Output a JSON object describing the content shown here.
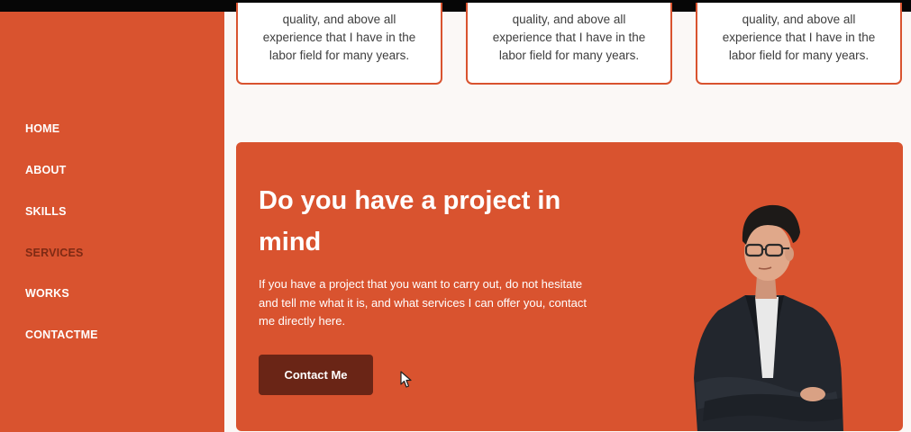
{
  "nav": {
    "items": [
      {
        "label": "HOME",
        "active": false
      },
      {
        "label": "ABOUT",
        "active": false
      },
      {
        "label": "SKILLS",
        "active": false
      },
      {
        "label": "SERVICES",
        "active": true
      },
      {
        "label": "WORKS",
        "active": false
      },
      {
        "label": "CONTACTME",
        "active": false
      }
    ]
  },
  "service_cards": [
    {
      "lines": [
        "quality, and above all",
        "experience that I have in the",
        "labor field for many years."
      ]
    },
    {
      "lines": [
        "quality, and above all",
        "experience that I have in the",
        "labor field for many years."
      ]
    },
    {
      "lines": [
        "quality, and above all",
        "experience that I have in the",
        "labor field for many years."
      ]
    }
  ],
  "cta": {
    "title_line1": "Do you have a project in",
    "title_line2": "mind",
    "text_line1": "If you have a project that you want to carry out, do not hesitate",
    "text_line2": "and tell me what it is, and what services I can offer you, contact",
    "text_line3": "me directly here.",
    "button_label": "Contact Me"
  },
  "colors": {
    "accent": "#d9532f",
    "button_dark": "#6a2516",
    "nav_active": "#7e2a14",
    "background": "#fbf8f6"
  },
  "icons": {
    "cursor": "mouse-pointer-icon"
  }
}
